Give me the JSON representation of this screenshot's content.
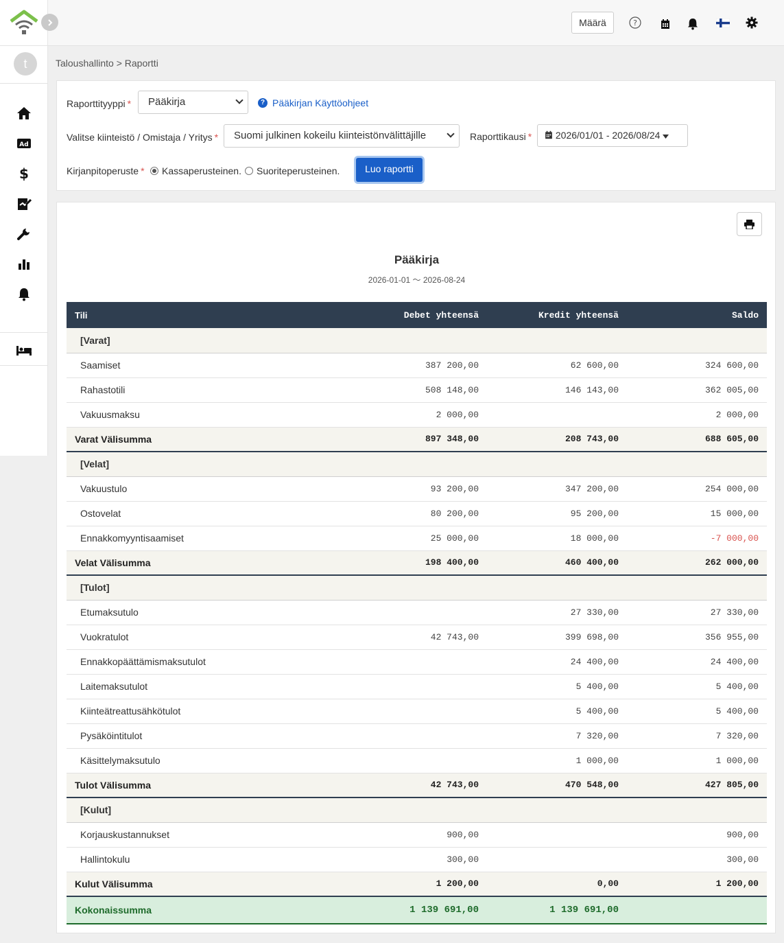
{
  "topbar": {
    "amount_button": "Määrä",
    "icons": [
      "help-icon",
      "calendar-icon",
      "bell-icon",
      "finnish-flag-icon",
      "gear-icon"
    ]
  },
  "sidebar": {
    "avatar_letter": "t",
    "items": [
      "home-icon",
      "ad-icon",
      "dollar-icon",
      "signature-icon",
      "wrench-icon",
      "chart-icon",
      "bell-icon",
      "bed-icon"
    ]
  },
  "breadcrumb": "Taloushallinto > Raportti",
  "filters": {
    "report_type_label": "Raporttityyppi",
    "report_type_value": "Pääkirja",
    "help_link": "Pääkirjan Käyttöohjeet",
    "property_label": "Valitse kiinteistö / Omistaja / Yritys",
    "property_value": "Suomi julkinen kokeilu kiinteistönvälittäjille",
    "period_label": "Raporttikausi",
    "period_value": "2026/01/01 - 2026/08/24",
    "basis_label": "Kirjanpitoperuste",
    "basis_cash": "Kassaperusteinen.",
    "basis_accrual": "Suoriteperusteinen.",
    "create_button": "Luo raportti",
    "required_mark": "*"
  },
  "report": {
    "title": "Pääkirja",
    "period": "2026-01-01 〜 2026-08-24",
    "columns": [
      "Tili",
      "Debet yhteensä",
      "Kredit yhteensä",
      "Saldo"
    ],
    "sections": [
      {
        "name": "[Varat]",
        "rows": [
          [
            "Saamiset",
            "387 200,00",
            "62 600,00",
            "324 600,00"
          ],
          [
            "Rahastotili",
            "508 148,00",
            "146 143,00",
            "362 005,00"
          ],
          [
            "Vakuusmaksu",
            "2 000,00",
            "",
            "2 000,00"
          ]
        ],
        "subtotal": [
          "Varat Välisumma",
          "897 348,00",
          "208 743,00",
          "688 605,00"
        ]
      },
      {
        "name": "[Velat]",
        "rows": [
          [
            "Vakuustulo",
            "93 200,00",
            "347 200,00",
            "254 000,00"
          ],
          [
            "Ostovelat",
            "80 200,00",
            "95 200,00",
            "15 000,00"
          ],
          [
            "Ennakkomyyntisaamiset",
            "25 000,00",
            "18 000,00",
            "-7 000,00"
          ]
        ],
        "subtotal": [
          "Velat Välisumma",
          "198 400,00",
          "460 400,00",
          "262 000,00"
        ]
      },
      {
        "name": "[Tulot]",
        "rows": [
          [
            "Etumaksutulo",
            "",
            "27 330,00",
            "27 330,00"
          ],
          [
            "Vuokratulot",
            "42 743,00",
            "399 698,00",
            "356 955,00"
          ],
          [
            "Ennakkopäättämismaksutulot",
            "",
            "24 400,00",
            "24 400,00"
          ],
          [
            "Laitemaksutulot",
            "",
            "5 400,00",
            "5 400,00"
          ],
          [
            "Kiinteätreattusähkötulot",
            "",
            "5 400,00",
            "5 400,00"
          ],
          [
            "Pysäköintitulot",
            "",
            "7 320,00",
            "7 320,00"
          ],
          [
            "Käsittelymaksutulo",
            "",
            "1 000,00",
            "1 000,00"
          ]
        ],
        "subtotal": [
          "Tulot Välisumma",
          "42 743,00",
          "470 548,00",
          "427 805,00"
        ]
      },
      {
        "name": "[Kulut]",
        "rows": [
          [
            "Korjauskustannukset",
            "900,00",
            "",
            "900,00"
          ],
          [
            "Hallintokulu",
            "300,00",
            "",
            "300,00"
          ]
        ],
        "subtotal": [
          "Kulut Välisumma",
          "1 200,00",
          "0,00",
          "1 200,00"
        ]
      }
    ],
    "total": [
      "Kokonaissumma",
      "1 139 691,00",
      "1 139 691,00",
      ""
    ]
  }
}
